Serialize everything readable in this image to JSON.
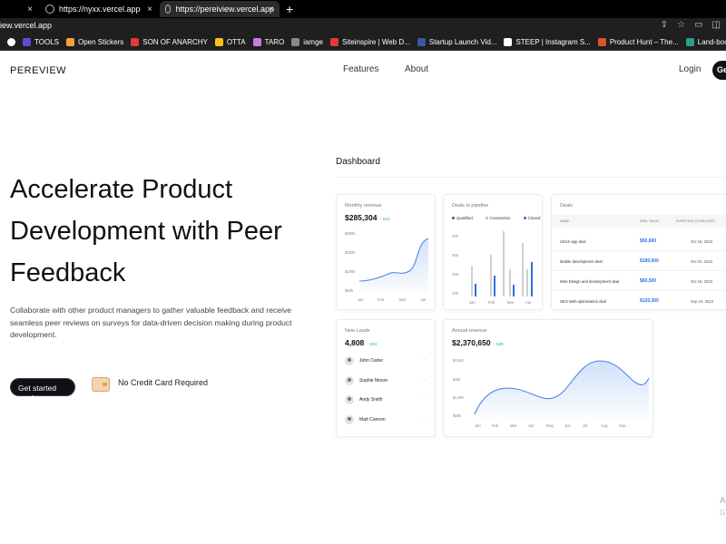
{
  "browser": {
    "tabs": [
      {
        "title": "https://nyxx.vercel.app"
      },
      {
        "title": "https://pereiview.vercel.app"
      }
    ],
    "new_tab": "+",
    "close": "×",
    "url": "iew.vercel.app",
    "bookmarks": [
      {
        "label": "TOOLS",
        "color": "#5a4fcf"
      },
      {
        "label": "Open Stickers",
        "color": "#f4a236"
      },
      {
        "label": "SON OF ANARCHY",
        "color": "#e53935"
      },
      {
        "label": "OTTA",
        "color": "#f5c518"
      },
      {
        "label": "TARO",
        "color": "#c97be0"
      },
      {
        "label": "iamge",
        "color": "#888888"
      },
      {
        "label": "Siteinspire | Web D...",
        "color": "#e53935"
      },
      {
        "label": "Startup Launch Vid...",
        "color": "#3b5998"
      },
      {
        "label": "STEEP | Instagram S...",
        "color": "#ffffff"
      },
      {
        "label": "Product Hunt – The...",
        "color": "#da552f"
      },
      {
        "label": "Land-book - websit...",
        "color": "#2a9d8f"
      },
      {
        "label": "BRANDS",
        "color": "#7a7aff"
      }
    ]
  },
  "nav": {
    "logo": "PEREVIEW",
    "links": [
      "Features",
      "About"
    ],
    "login": "Login",
    "cta": "Ge"
  },
  "hero": {
    "title": "Accelerate Product Development with Peer Feedback",
    "description": "Collaborate with other product managers to gather valuable feedback and receive seamless peer reviews on surveys for data-driven decision making during product development.",
    "cta": "Get started",
    "cta_arrow": "⟶",
    "note": "No Credit Card Required"
  },
  "dashboard": {
    "title": "Dashboard",
    "monthly": {
      "label": "Monthly revenue",
      "value": "$285,304",
      "change": "↑ 512",
      "y_ticks": [
        "$300k",
        "$200k",
        "$100k",
        "$50k"
      ],
      "x_ticks": [
        "Jan",
        "Feb",
        "Mar",
        "Apr"
      ]
    },
    "pipeline": {
      "label": "Deals in pipeline",
      "legend": [
        {
          "name": "Qualified",
          "color": "#555555"
        },
        {
          "name": "Connection",
          "color": "#bbbbbb"
        },
        {
          "name": "Closed",
          "color": "#2f6fe0"
        }
      ],
      "y_ticks": [
        "400",
        "300",
        "200",
        "100"
      ],
      "x_ticks": [
        "Jan",
        "Feb",
        "Mar",
        "Apr"
      ]
    },
    "deals": {
      "label": "Deals",
      "headers": [
        "NAME",
        "DEAL VALUE",
        "EXPECTED CLOSE DATE"
      ],
      "rows": [
        {
          "name": "UI/UX app deal",
          "value": "$50,600",
          "date": "Oct 16, 2023"
        },
        {
          "name": "Mobile development deal",
          "value": "$180,600",
          "date": "Oct 10, 2023"
        },
        {
          "name": "Web Design and development deal",
          "value": "$60,500",
          "date": "Oct 16, 2023"
        },
        {
          "name": "SEO Web optimization deal",
          "value": "$120,300",
          "date": "Sep 16, 2023"
        }
      ]
    },
    "leads": {
      "label": "New Leads",
      "value": "4,808",
      "change": "↑ 524",
      "people": [
        "John Carter",
        "Sophie Moore",
        "Andy Smith",
        "Matt Cannon"
      ],
      "more": "···"
    },
    "annual": {
      "label": "Annual revenue",
      "value": "$2,370,650",
      "change": "↑ 530",
      "y_ticks": [
        "$3.5M",
        "$3M",
        "$1.5M",
        "$50k"
      ],
      "x_ticks": [
        "Jan",
        "Feb",
        "Mar",
        "Apr",
        "May",
        "Jun",
        "Jul",
        "Aug",
        "Sep"
      ]
    }
  },
  "watermark": {
    "line1": "A",
    "line2": "G"
  }
}
